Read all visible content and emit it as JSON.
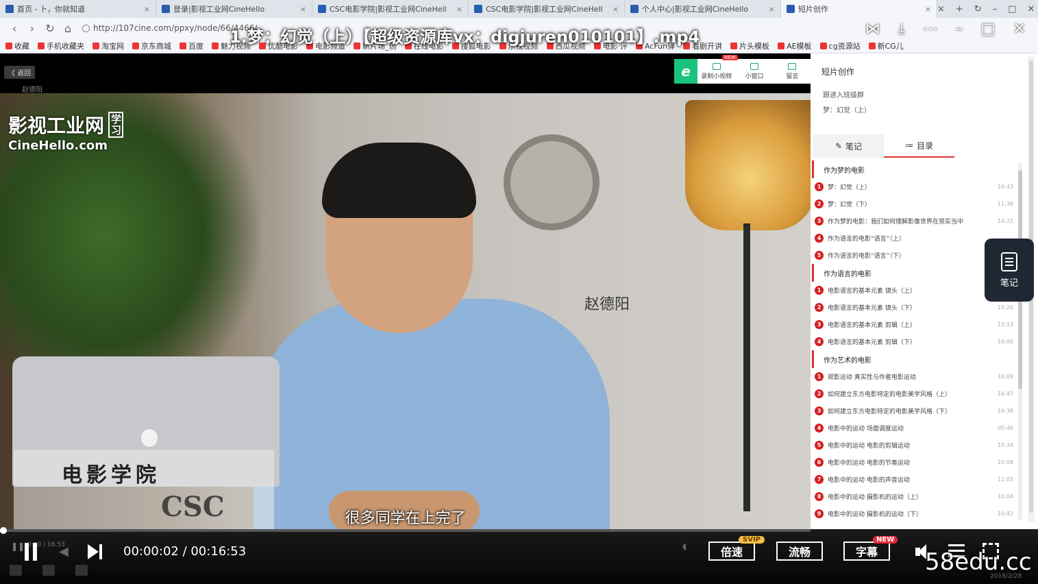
{
  "browser": {
    "tabs": [
      {
        "title": "首页 - 卜，你就知道",
        "active": false
      },
      {
        "title": "登录|影视工业网CineHello",
        "active": false
      },
      {
        "title": "CSC电影学院|影视工业网CineHell",
        "active": false
      },
      {
        "title": "CSC电影学院|影视工业网CineHell",
        "active": false
      },
      {
        "title": "个人中心|影视工业网CineHello",
        "active": false
      },
      {
        "title": "短片创作",
        "active": true
      }
    ],
    "url": "http://107cine.com/ppxy/node/66/4466/",
    "bookmarks": [
      "收藏",
      "手机收藏夹",
      "淘宝网",
      "京东商城",
      "百度",
      "魅力视频",
      "优酷电影",
      "电影频道",
      "新片场_创",
      "在线电影",
      "搜狐电影",
      "乐视视频",
      "西瓜视频",
      "电影·评",
      "AcFun弹",
      "看剧开讲",
      "片头模板",
      "AE模板",
      "cg资源站",
      "新CG儿"
    ]
  },
  "player": {
    "title": "1.梦：幻觉（上）【超级资源库vx：digjuren010101】.mp4",
    "current_time": "00:00:02",
    "total_time": "00:16:53",
    "progress": 0.002,
    "speed_label": "倍速",
    "quality_label": "流畅",
    "caption_label": "字幕",
    "svip_badge": "SVIP",
    "new_badge": "NEW",
    "subtitle": "很多同学在上完了",
    "speaker": "赵德阳",
    "ghost_time": "0:00 / 16:53",
    "ghost_date": "2018/2/28",
    "corner_logo": "58edu.cc"
  },
  "video_page": {
    "back_label": "返回",
    "back_sub": "赵德阳",
    "watermark_cn": "影视工业网",
    "watermark_learn": "学习",
    "watermark_en": "CineHello.com",
    "plaque_1": "电影学院",
    "plaque_2": "CSC"
  },
  "recorder": {
    "items": [
      "录制小视频",
      "小窗口",
      "留言"
    ],
    "new_tag": "NEW"
  },
  "sidebar": {
    "title": "短片创作",
    "sub1": "跟进入班级群",
    "sub2": "梦：幻觉（上）",
    "tab_notes": "笔记",
    "tab_catalog": "目录",
    "sections": [
      {
        "title": "作为梦的电影",
        "lessons": [
          {
            "n": "1",
            "title": "梦：幻觉（上）",
            "dur": "16:43"
          },
          {
            "n": "2",
            "title": "梦：幻觉（下）",
            "dur": "11:38"
          },
          {
            "n": "3",
            "title": "作为梦的电影：我们如何理解影像世界在现实当中",
            "dur": "14:22"
          },
          {
            "n": "4",
            "title": "作为语言的电影“语言”（上）",
            "dur": ""
          },
          {
            "n": "5",
            "title": "作为语言的电影“语言”（下）",
            "dur": ""
          }
        ]
      },
      {
        "title": "作为语言的电影",
        "lessons": [
          {
            "n": "1",
            "title": "电影语言的基本元素 镜头（上）",
            "dur": ""
          },
          {
            "n": "2",
            "title": "电影语言的基本元素 镜头（下）",
            "dur": "15:20"
          },
          {
            "n": "3",
            "title": "电影语言的基本元素 剪辑（上）",
            "dur": "15:13"
          },
          {
            "n": "4",
            "title": "电影语言的基本元素 剪辑（下）",
            "dur": "16:00"
          }
        ]
      },
      {
        "title": "作为艺术的电影",
        "lessons": [
          {
            "n": "1",
            "title": "观影运动 真实性与作者电影运动",
            "dur": "16:09"
          },
          {
            "n": "2",
            "title": "如何建立东方电影特定的电影美学风格（上）",
            "dur": "16:47"
          },
          {
            "n": "3",
            "title": "如何建立东方电影特定的电影美学风格（下）",
            "dur": "16:38"
          },
          {
            "n": "4",
            "title": "电影中的运动 场面调度运动",
            "dur": "05:46"
          },
          {
            "n": "5",
            "title": "电影中的运动 电影的剪辑运动",
            "dur": "10:34"
          },
          {
            "n": "6",
            "title": "电影中的运动 电影的节奏运动",
            "dur": "10:08"
          },
          {
            "n": "7",
            "title": "电影中的运动 电影的声音运动",
            "dur": "11:03"
          },
          {
            "n": "8",
            "title": "电影中的运动 摄影机的运动（上）",
            "dur": "10:04"
          },
          {
            "n": "9",
            "title": "电影中的运动 摄影机的运动（下）",
            "dur": "10:42"
          }
        ]
      }
    ],
    "notes_float_label": "笔记"
  },
  "colors": {
    "accent": "#d61f1f",
    "recorder_green": "#19c37d",
    "svip": "#f5c146",
    "new": "#e8293a"
  }
}
